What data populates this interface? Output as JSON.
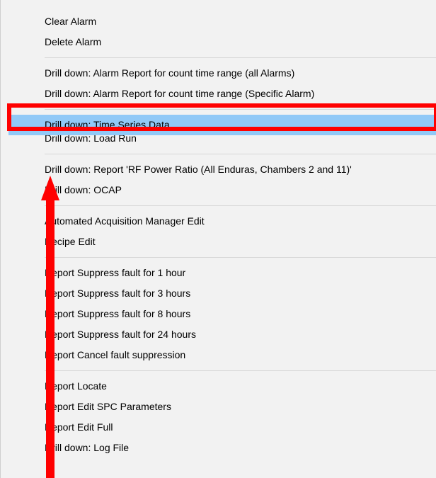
{
  "menu": {
    "sections": [
      {
        "items": [
          {
            "name": "menu-item-clear-alarm",
            "label": "Clear Alarm"
          },
          {
            "name": "menu-item-delete-alarm",
            "label": "Delete Alarm"
          }
        ]
      },
      {
        "items": [
          {
            "name": "menu-item-drilldown-alarm-report-all",
            "label": "Drill down: Alarm Report for count time range (all Alarms)"
          },
          {
            "name": "menu-item-drilldown-alarm-report-specific",
            "label": "Drill down: Alarm Report for count time range (Specific Alarm)"
          }
        ]
      },
      {
        "items": [
          {
            "name": "menu-item-drilldown-time-series",
            "label": "Drill down: Time Series Data",
            "highlighted": true
          },
          {
            "name": "menu-item-drilldown-load-run",
            "label": "Drill down: Load Run",
            "partial": true
          }
        ]
      },
      {
        "items": [
          {
            "name": "menu-item-drilldown-report-rf-power",
            "label": "Drill down: Report 'RF Power Ratio (All Enduras, Chambers 2 and 11)'"
          },
          {
            "name": "menu-item-drilldown-ocap",
            "label": "Drill down: OCAP"
          }
        ]
      },
      {
        "items": [
          {
            "name": "menu-item-aam-edit",
            "label": "Automated Acquisition Manager Edit"
          },
          {
            "name": "menu-item-recipe-edit",
            "label": "Recipe Edit"
          }
        ]
      },
      {
        "items": [
          {
            "name": "menu-item-suppress-1h",
            "label": "Report Suppress fault for 1 hour"
          },
          {
            "name": "menu-item-suppress-3h",
            "label": "Report Suppress fault for 3 hours"
          },
          {
            "name": "menu-item-suppress-8h",
            "label": "Report Suppress fault for 8 hours"
          },
          {
            "name": "menu-item-suppress-24h",
            "label": "Report Suppress fault for 24 hours"
          },
          {
            "name": "menu-item-cancel-suppression",
            "label": "Report Cancel fault suppression"
          }
        ]
      },
      {
        "items": [
          {
            "name": "menu-item-report-locate",
            "label": "Report Locate"
          },
          {
            "name": "menu-item-report-edit-spc",
            "label": "Report Edit SPC Parameters"
          },
          {
            "name": "menu-item-report-edit-full",
            "label": "Report Edit Full"
          },
          {
            "name": "menu-item-drilldown-log-file",
            "label": "Drill down: Log File"
          }
        ]
      }
    ]
  },
  "annotation": {
    "highlight_color": "#ff0000",
    "menu_highlight_color": "#91c9f7"
  }
}
